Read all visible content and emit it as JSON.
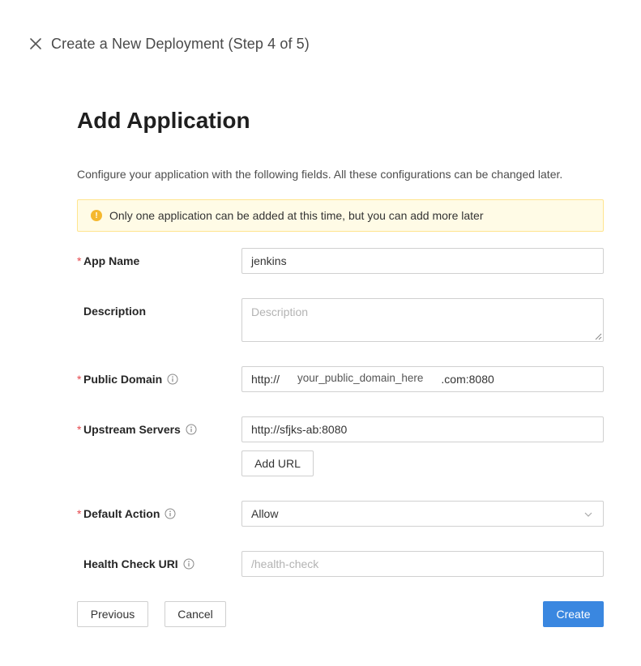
{
  "header": {
    "title": "Create a New Deployment (Step 4 of 5)"
  },
  "page": {
    "heading": "Add Application",
    "description": "Configure your application with the following fields. All these configurations can be changed later."
  },
  "alert": {
    "text": "Only one application can be added at this time, but you can add more later",
    "icon": "warning-icon",
    "color": "#f5b82e"
  },
  "form": {
    "app_name": {
      "label": "App Name",
      "required": true,
      "value": "jenkins"
    },
    "description": {
      "label": "Description",
      "required": false,
      "placeholder": "Description"
    },
    "public_domain": {
      "label": "Public Domain",
      "required": true,
      "prefix": "http://",
      "middle": "your_public_domain_here",
      "suffix": ".com:8080"
    },
    "upstream_servers": {
      "label": "Upstream Servers",
      "required": true,
      "value": "http://sfjks-ab:8080",
      "add_url_label": "Add URL"
    },
    "default_action": {
      "label": "Default Action",
      "required": true,
      "value": "Allow"
    },
    "health_check_uri": {
      "label": "Health Check URI",
      "required": false,
      "placeholder": "/health-check"
    }
  },
  "footer": {
    "previous_label": "Previous",
    "cancel_label": "Cancel",
    "create_label": "Create"
  },
  "colors": {
    "primary": "#3a87e0",
    "required": "#e5484d",
    "alert_bg": "#fffbe6",
    "alert_border": "#ffe58f"
  }
}
